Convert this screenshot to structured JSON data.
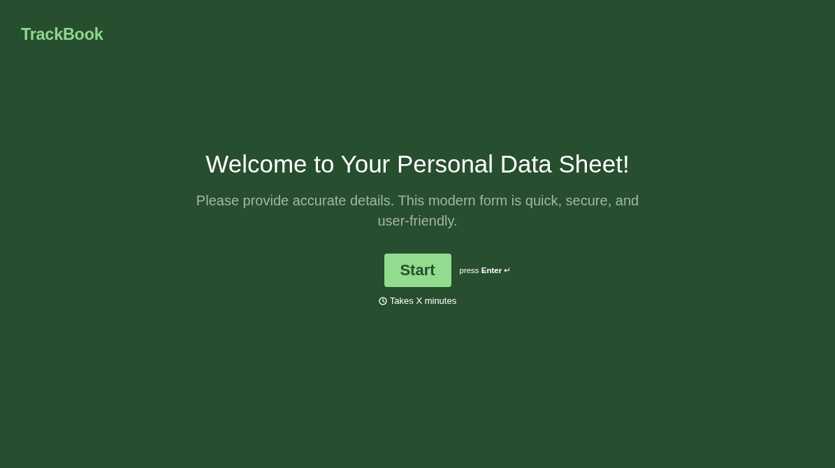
{
  "header": {
    "logo": "TrackBook"
  },
  "intro": {
    "title": "Welcome to Your Personal Data Sheet!",
    "description": "Please provide accurate details. This modern form is quick, secure, and user-friendly."
  },
  "start": {
    "button": "Start",
    "hint": "press **Enter** ↵",
    "duration": "Takes X minutes"
  }
}
